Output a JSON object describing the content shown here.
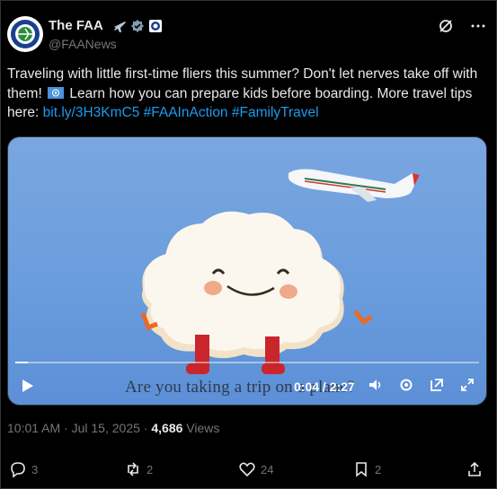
{
  "author": {
    "display_name": "The FAA",
    "handle": "@FAANews",
    "badge_icons": [
      "airplane-emoji",
      "verified-gray-badge",
      "affiliate-badge"
    ]
  },
  "header_actions": [
    "grok-icon",
    "more-icon"
  ],
  "tweet": {
    "text_part1": "Traveling with little first-time fliers this summer? Don't let nerves take off with them! ",
    "flag_icon": "united-nations-flag-emoji",
    "text_part2": " Learn how you can prepare kids before boarding. More travel tips here: ",
    "link": "bit.ly/3H3KmC5",
    "hashtag1": "#FAAInAction",
    "hashtag2": "#FamilyTravel"
  },
  "video": {
    "caption": "Are you taking a trip on a plane?",
    "current_time": "0:04",
    "duration": "2:27",
    "timecode": "0:04 / 2:27",
    "progress_fraction": 0.027,
    "controls": [
      "volume-icon",
      "settings-icon",
      "popout-icon",
      "fullscreen-icon"
    ]
  },
  "meta": {
    "time": "10:01 AM",
    "date": "Jul 15, 2025",
    "views_count": "4,686",
    "views_label": "Views"
  },
  "actions": {
    "replies": "3",
    "reposts": "2",
    "likes": "24",
    "bookmarks": "2"
  },
  "colors": {
    "background": "#000000",
    "text": "#e7e9ea",
    "muted": "#71767b",
    "link": "#1d9bf0",
    "sky": "#6a9ddd"
  }
}
